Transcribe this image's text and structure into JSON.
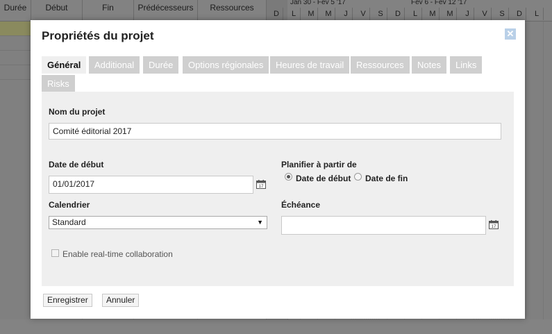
{
  "background": {
    "columns": [
      "Durée",
      "Début",
      "Fin",
      "Prédécesseurs",
      "Ressources"
    ],
    "weeks": [
      "Jan 30 - Fév 5 '17",
      "Fév 6 - Fév 12 '17"
    ],
    "days": [
      "D",
      "L",
      "M",
      "M",
      "J",
      "V",
      "S",
      "D",
      "L",
      "M",
      "M",
      "J",
      "V",
      "S",
      "D",
      "L"
    ]
  },
  "dialog": {
    "title": "Propriétés du projet",
    "close_icon": "close-icon"
  },
  "tabs": [
    {
      "label": "Général",
      "active": true
    },
    {
      "label": "Additional"
    },
    {
      "label": "Durée"
    },
    {
      "label": "Options régionales"
    },
    {
      "label": "Heures de travail"
    },
    {
      "label": "Ressources"
    },
    {
      "label": "Notes"
    },
    {
      "label": "Links"
    },
    {
      "label": "Risks"
    }
  ],
  "form": {
    "project_name_label": "Nom du projet",
    "project_name_value": "Comité éditorial 2017",
    "start_date_label": "Date de début",
    "start_date_value": "01/01/2017",
    "schedule_from_label": "Planifier à partir de",
    "schedule_from_options": [
      "Date de début",
      "Date de fin"
    ],
    "schedule_from_selected": "Date de début",
    "calendar_label": "Calendrier",
    "calendar_value": "Standard",
    "deadline_label": "Échéance",
    "deadline_value": "",
    "collab_label": "Enable real-time collaboration",
    "collab_checked": false
  },
  "buttons": {
    "save": "Enregistrer",
    "cancel": "Annuler"
  },
  "colors": {
    "tab_inactive": "#cfcfcf",
    "panel": "#efefef",
    "close": "#b9d0e8"
  }
}
